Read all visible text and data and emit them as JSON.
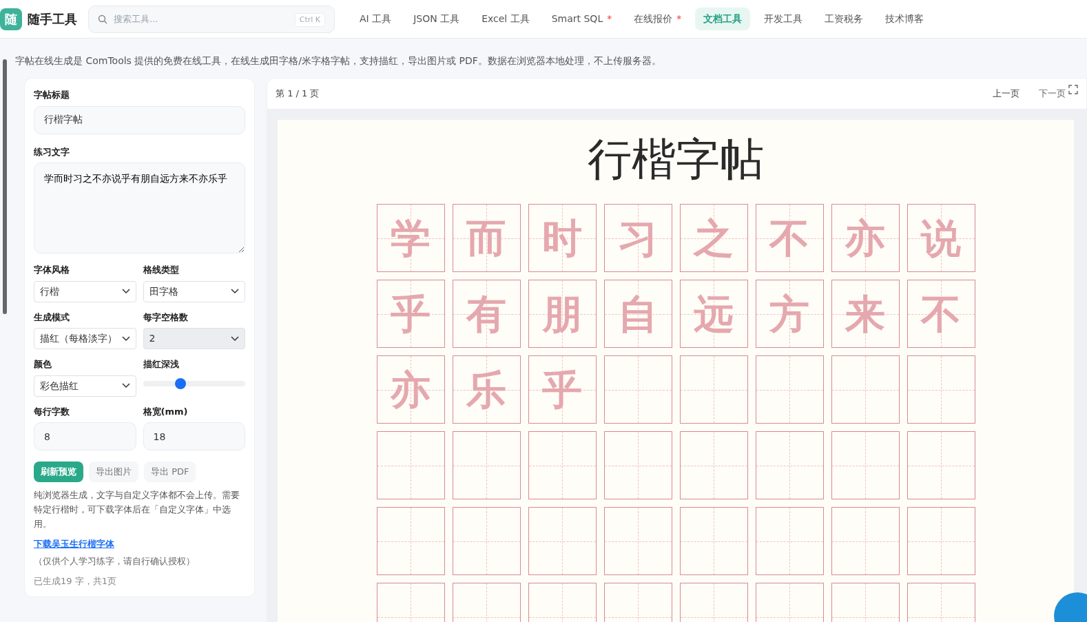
{
  "brand": {
    "logo": "随",
    "name": "随手工具"
  },
  "search": {
    "placeholder": "搜索工具...",
    "shortcut": "Ctrl K"
  },
  "nav": [
    {
      "label": "AI 工具",
      "selected": false,
      "starred": false
    },
    {
      "label": "JSON 工具",
      "selected": false,
      "starred": false
    },
    {
      "label": "Excel 工具",
      "selected": false,
      "starred": false
    },
    {
      "label": "Smart SQL",
      "selected": false,
      "starred": true,
      "star": "*"
    },
    {
      "label": "在线报价",
      "selected": false,
      "starred": true,
      "star": "*"
    },
    {
      "label": "文档工具",
      "selected": true,
      "starred": false
    },
    {
      "label": "开发工具",
      "selected": false,
      "starred": false
    },
    {
      "label": "工资税务",
      "selected": false,
      "starred": false
    },
    {
      "label": "技术博客",
      "selected": false,
      "starred": false
    }
  ],
  "intro": "字帖在线生成是 ComTools 提供的免费在线工具，在线生成田字格/米字格字帖，支持描红，导出图片或 PDF。数据在浏览器本地处理，不上传服务器。",
  "form": {
    "title_label": "字帖标题",
    "title_value": "行楷字帖",
    "text_label": "练习文字",
    "text_value": "学而时习之不亦说乎有朋自远方来不亦乐乎",
    "fields": [
      {
        "kind": "select",
        "label": "字体风格",
        "value": "行楷",
        "disabled": false
      },
      {
        "kind": "select",
        "label": "格线类型",
        "value": "田字格",
        "disabled": false
      },
      {
        "kind": "select",
        "label": "生成模式",
        "value": "描红（每格淡字）",
        "disabled": false
      },
      {
        "kind": "select",
        "label": "每字空格数",
        "value": "2",
        "disabled": true
      },
      {
        "kind": "select",
        "label": "颜色",
        "value": "彩色描红",
        "disabled": false
      },
      {
        "kind": "slider",
        "label": "描红深浅",
        "level": 0.37
      },
      {
        "kind": "input",
        "label": "每行字数",
        "value": "8"
      },
      {
        "kind": "input",
        "label": "格宽(mm)",
        "value": "18"
      }
    ],
    "buttons": [
      {
        "label": "刷新预览",
        "primary": true
      },
      {
        "label": "导出图片",
        "primary": false
      },
      {
        "label": "导出 PDF",
        "primary": false
      }
    ],
    "note": "纯浏览器生成，文字与自定义字体都不会上传。需要特定行楷时，可下载字体后在「自定义字体」中选用。",
    "link": "下载吴玉生行楷字体",
    "link_note": "（仅供个人学习练字，请自行确认授权）",
    "status": "已生成19 字，共1页"
  },
  "preview": {
    "page_label": "第 1 / 1 页",
    "prev": "上一页",
    "next": "下一页",
    "sheet_title": "行楷字帖",
    "rows": [
      [
        {
          "char": "学"
        },
        {
          "char": "而"
        },
        {
          "char": "时"
        },
        {
          "char": "习"
        },
        {
          "char": "之"
        },
        {
          "char": "不"
        },
        {
          "char": "亦"
        },
        {
          "char": "说"
        }
      ],
      [
        {
          "char": "乎"
        },
        {
          "char": "有"
        },
        {
          "char": "朋"
        },
        {
          "char": "自"
        },
        {
          "char": "远"
        },
        {
          "char": "方"
        },
        {
          "char": "来"
        },
        {
          "char": "不"
        }
      ],
      [
        {
          "char": "亦"
        },
        {
          "char": "乐"
        },
        {
          "char": "乎"
        },
        {},
        {},
        {},
        {},
        {}
      ],
      [
        {},
        {},
        {},
        {},
        {},
        {},
        {},
        {}
      ],
      [
        {},
        {},
        {},
        {},
        {},
        {},
        {},
        {}
      ],
      [
        {},
        {},
        {},
        {},
        {},
        {},
        {},
        {}
      ]
    ]
  }
}
